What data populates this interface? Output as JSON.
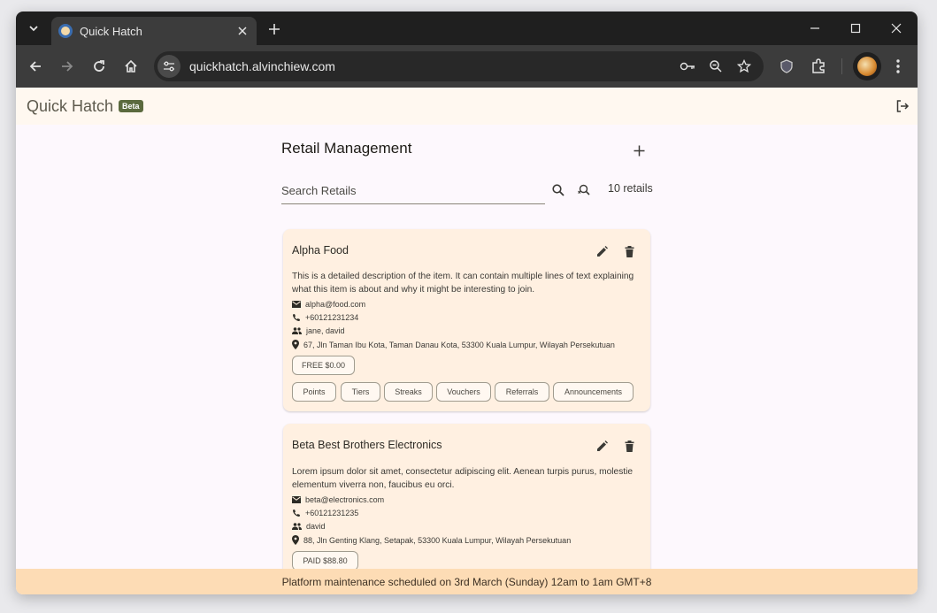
{
  "browser": {
    "tab_title": "Quick Hatch",
    "url": "quickhatch.alvinchiew.com"
  },
  "header": {
    "app_title": "Quick Hatch",
    "badge": "Beta"
  },
  "main": {
    "title": "Retail Management",
    "search_placeholder": "Search Retails",
    "count_label": "10 retails"
  },
  "retails": [
    {
      "name": "Alpha Food",
      "description": "This is a detailed description of the item. It can contain multiple lines of text explaining what this item is about and why it might be interesting to join.",
      "email": "alpha@food.com",
      "phone": "+60121231234",
      "users": "jane, david",
      "address": "67, Jln Taman Ibu Kota, Taman Danau Kota, 53300 Kuala Lumpur, Wilayah Persekutuan",
      "plan": "FREE $0.00",
      "features": [
        "Points",
        "Tiers",
        "Streaks",
        "Vouchers",
        "Referrals",
        "Announcements"
      ]
    },
    {
      "name": "Beta Best Brothers Electronics",
      "description": "Lorem ipsum dolor sit amet, consectetur adipiscing elit. Aenean turpis purus, molestie elementum viverra non, faucibus eu orci.",
      "email": "beta@electronics.com",
      "phone": "+60121231235",
      "users": "david",
      "address": "88, Jln Genting Klang, Setapak, 53300 Kuala Lumpur, Wilayah Persekutuan",
      "plan": "PAID $88.80"
    }
  ],
  "footer": {
    "announcement": "Platform maintenance scheduled on 3rd March (Sunday) 12am to 1am GMT+8"
  }
}
